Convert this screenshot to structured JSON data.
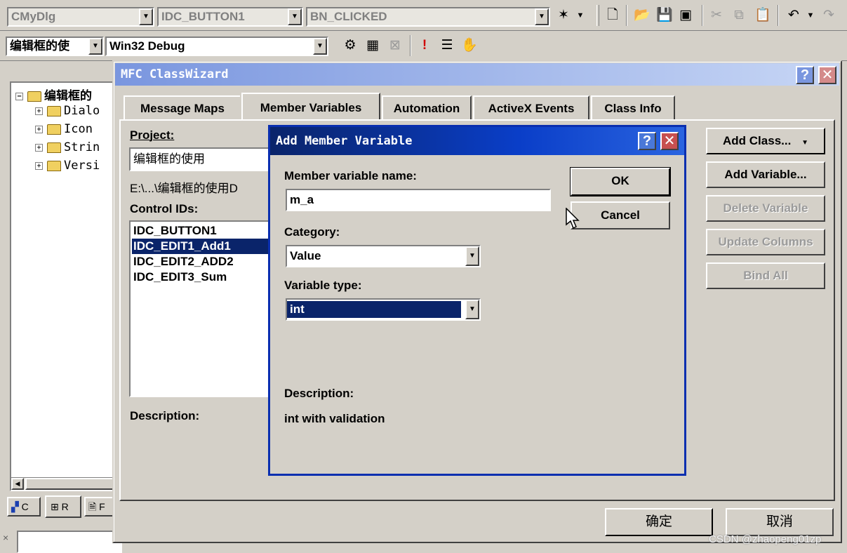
{
  "toolbar": {
    "class_combo": "CMyDlg",
    "id_combo": "IDC_BUTTON1",
    "msg_combo": "BN_CLICKED",
    "project_combo": "编辑框的使",
    "config_combo": "Win32 Debug"
  },
  "workspace": {
    "root": "编辑框的",
    "items": [
      "Dialo",
      "Icon",
      "Strin",
      "Versi"
    ],
    "tabs": [
      "C",
      "R",
      "F"
    ]
  },
  "classwizard": {
    "title": "MFC ClassWizard",
    "tabs": [
      "Message Maps",
      "Member Variables",
      "Automation",
      "ActiveX Events",
      "Class Info"
    ],
    "project_label": "Project:",
    "project_value": "编辑框的使用",
    "path": "E:\\...\\编辑框的使用D",
    "control_ids_label": "Control IDs:",
    "control_ids": [
      "IDC_BUTTON1",
      "IDC_EDIT1_Add1",
      "IDC_EDIT2_ADD2",
      "IDC_EDIT3_Sum"
    ],
    "selected_index": 1,
    "description_label": "Description:",
    "buttons": {
      "add_class": "Add Class...",
      "add_variable": "Add Variable...",
      "delete_variable": "Delete Variable",
      "update_columns": "Update Columns",
      "bind_all": "Bind All"
    },
    "ok": "确定",
    "cancel": "取消"
  },
  "add_member": {
    "title": "Add Member Variable",
    "name_label": "Member variable name:",
    "name_value": "m_a",
    "category_label": "Category:",
    "category_value": "Value",
    "type_label": "Variable type:",
    "type_value": "int",
    "description_label": "Description:",
    "description_value": "int with validation",
    "ok": "OK",
    "cancel": "Cancel"
  },
  "watermark": "CSDN @zhaopeng01zp",
  "colors": {
    "title_active": "#0a246a",
    "title_gradient_end": "#a6caf0",
    "title_inactive": "#7a96df",
    "selection": "#0a246a",
    "close_red": "#c75050"
  }
}
